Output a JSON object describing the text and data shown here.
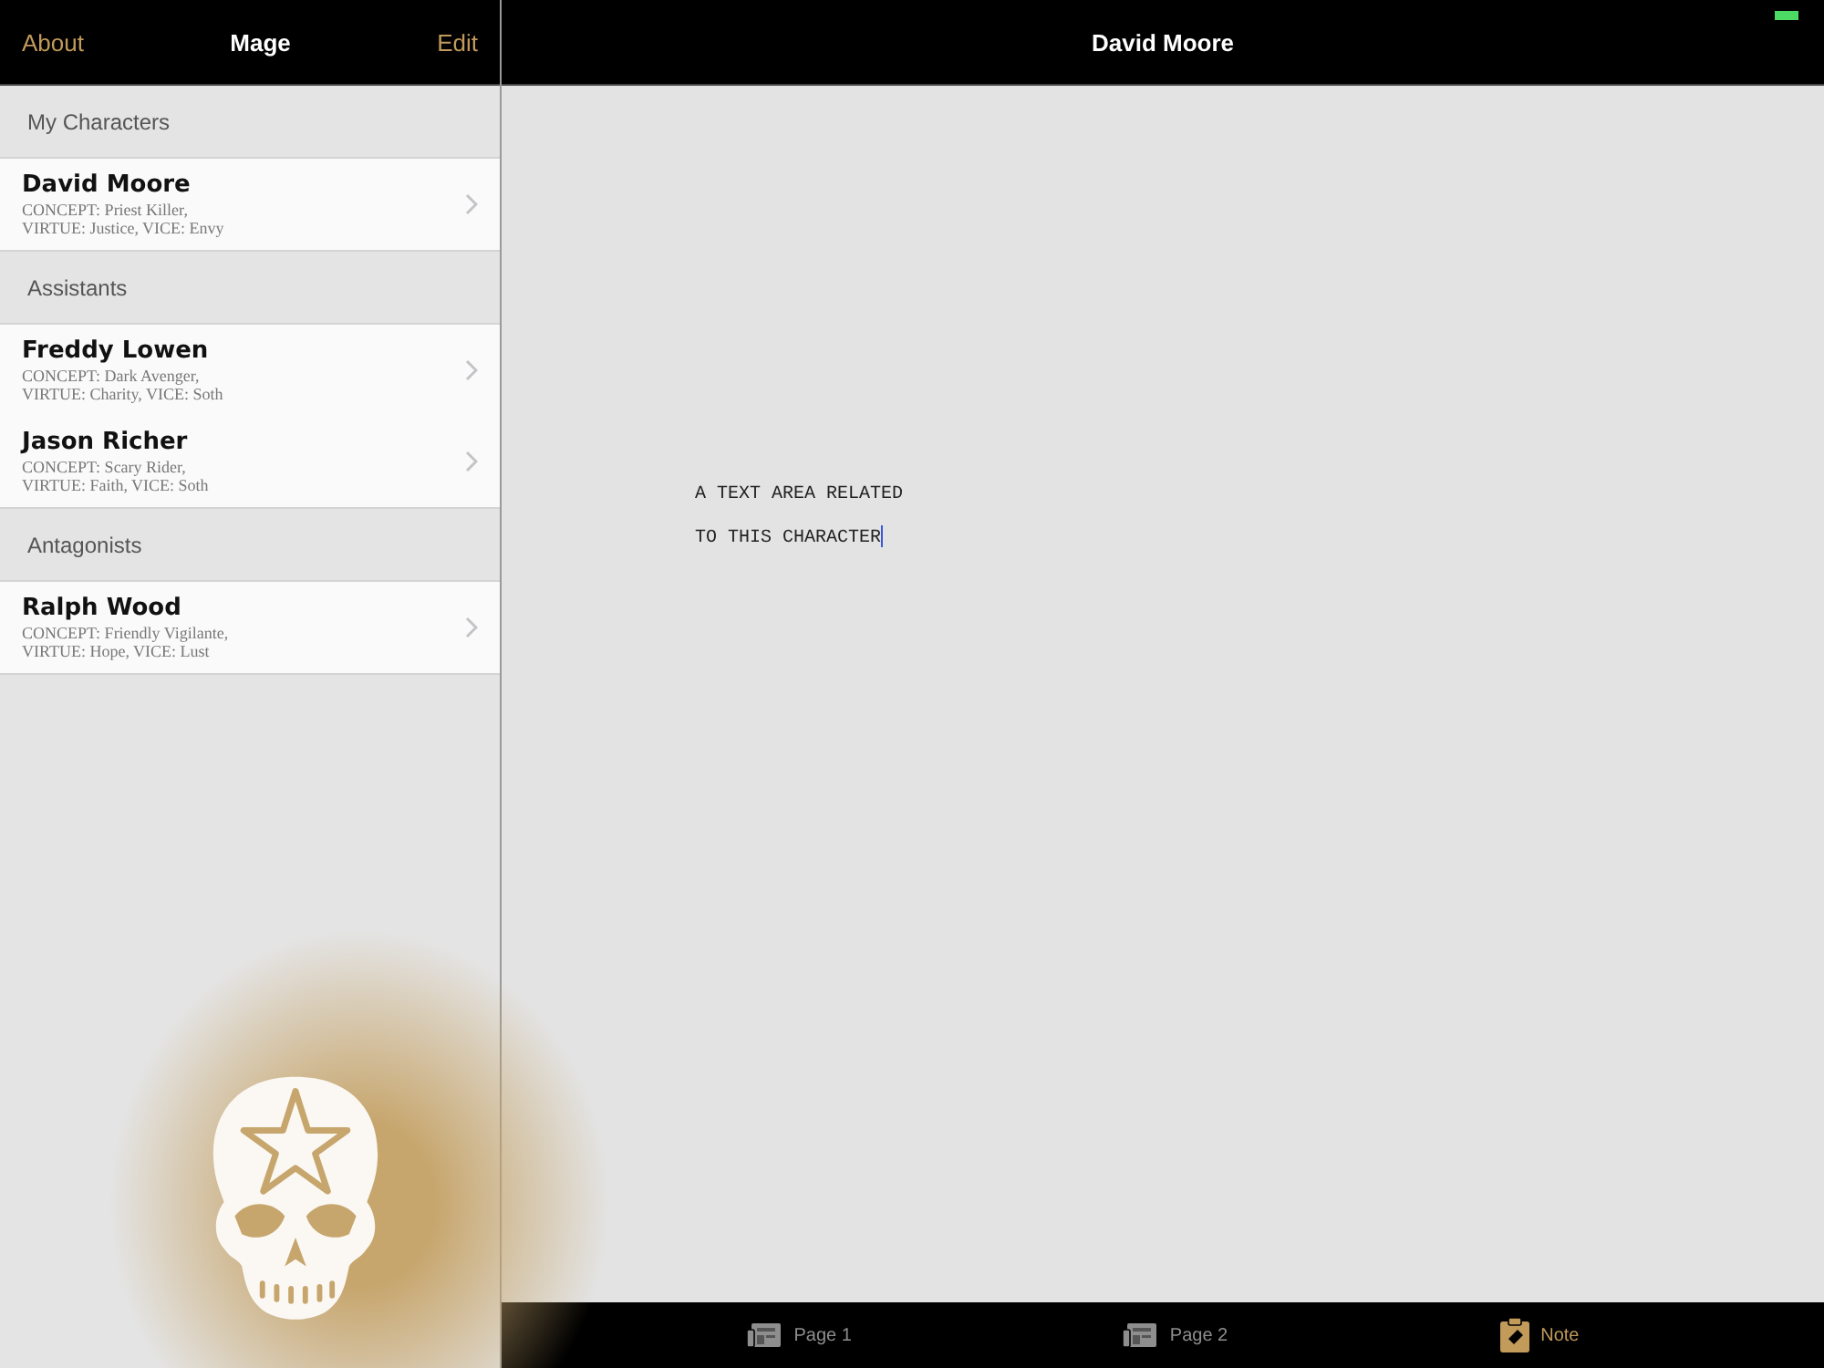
{
  "master": {
    "left_button": "About",
    "title": "Mage",
    "right_button": "Edit",
    "sections": [
      {
        "title": "My Characters",
        "items": [
          {
            "name": "David Moore",
            "details": [
              "CONCEPT: Priest Killer,",
              "VIRTUE: Justice, VICE: Envy"
            ]
          }
        ]
      },
      {
        "title": "Assistants",
        "items": [
          {
            "name": "Freddy Lowen",
            "details": [
              "CONCEPT: Dark Avenger,",
              "VIRTUE: Charity, VICE: Soth"
            ]
          },
          {
            "name": "Jason Richer",
            "details": [
              "CONCEPT: Scary Rider,",
              "VIRTUE: Faith, VICE: Soth"
            ]
          }
        ]
      },
      {
        "title": "Antagonists",
        "items": [
          {
            "name": "Ralph Wood",
            "details": [
              "CONCEPT: Friendly Vigilante,",
              "VIRTUE: Hope, VICE: Lust"
            ]
          }
        ]
      }
    ]
  },
  "detail": {
    "title": "David Moore",
    "text_area": {
      "value": "A TEXT AREA RELATED\nTO THIS CHARACTER"
    }
  },
  "tab_bar": [
    {
      "label": "Page 1",
      "kind": "page",
      "selected": false
    },
    {
      "label": "Page 2",
      "kind": "page",
      "selected": false
    },
    {
      "label": "Note",
      "kind": "note",
      "selected": true
    }
  ]
}
